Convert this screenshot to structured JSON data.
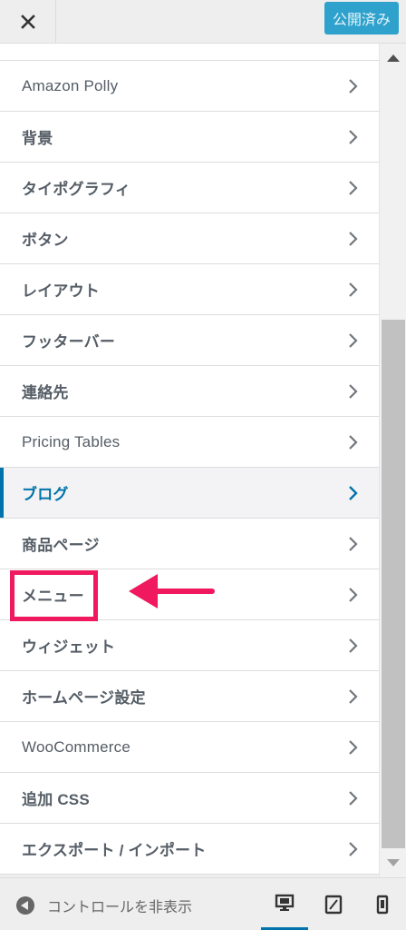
{
  "header": {
    "close_icon": "close-icon",
    "publish_label": "公開済み"
  },
  "sections": [
    {
      "label": "Amazon Polly"
    },
    {
      "label": "背景"
    },
    {
      "label": "タイポグラフィ"
    },
    {
      "label": "ボタン"
    },
    {
      "label": "レイアウト"
    },
    {
      "label": "フッターバー"
    },
    {
      "label": "連絡先"
    },
    {
      "label": "Pricing Tables"
    },
    {
      "label": "ブログ",
      "active": true
    },
    {
      "label": "商品ページ"
    },
    {
      "label": "メニュー"
    },
    {
      "label": "ウィジェット"
    },
    {
      "label": "ホームページ設定"
    },
    {
      "label": "WooCommerce"
    },
    {
      "label": "追加 CSS"
    },
    {
      "label": "エクスポート / インポート"
    }
  ],
  "footer": {
    "collapse_label": "コントロールを非表示",
    "devices": [
      "desktop-icon",
      "tablet-icon",
      "mobile-icon"
    ],
    "active_device": "desktop"
  },
  "colors": {
    "accent": "#0073aa",
    "publish_bg": "#2ea2cc",
    "annotation": "#f0185e"
  }
}
